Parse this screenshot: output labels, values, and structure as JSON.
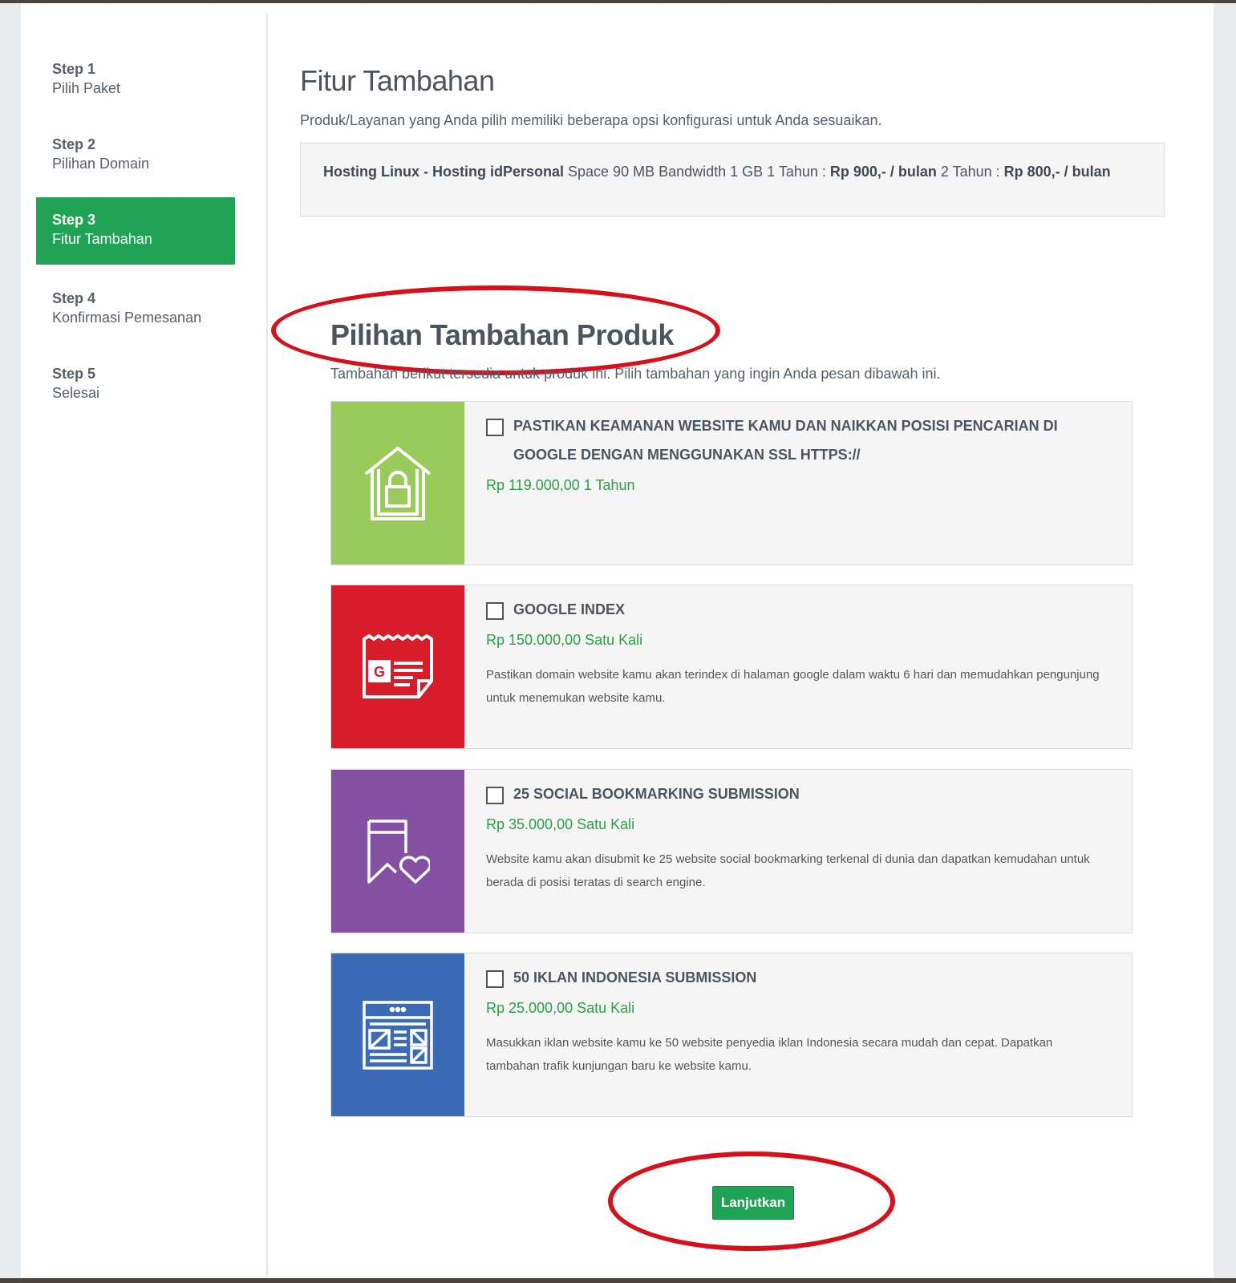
{
  "sidebar": {
    "steps": [
      {
        "num": "Step 1",
        "name": "Pilih Paket"
      },
      {
        "num": "Step 2",
        "name": "Pilihan Domain"
      },
      {
        "num": "Step 3",
        "name": "Fitur Tambahan"
      },
      {
        "num": "Step 4",
        "name": "Konfirmasi Pemesanan"
      },
      {
        "num": "Step 5",
        "name": "Selesai"
      }
    ]
  },
  "main": {
    "title": "Fitur Tambahan",
    "subtitle": "Produk/Layanan yang Anda pilih memiliki beberapa opsi konfigurasi untuk Anda sesuaikan.",
    "product": {
      "name": "Hosting Linux - Hosting idPersonal",
      "specs": " Space 90 MB Bandwidth 1 GB 1 Tahun : ",
      "price1": "Rp 900,- / bulan",
      "mid": " 2 Tahun : ",
      "price2": "Rp 800,- / bulan"
    },
    "addons_title": "Pilihan Tambahan Produk",
    "addons_subtitle": "Tambahan berikut tersedia untuk produk ini. Pilih tambahan yang ingin Anda pesan dibawah ini.",
    "addons": [
      {
        "title": "PASTIKAN KEAMANAN WEBSITE KAMU DAN NAIKKAN POSISI PENCARIAN DI GOOGLE DENGAN MENGGUNAKAN SSL HTTPS://",
        "price": "Rp 119.000,00 1 Tahun",
        "desc": "",
        "icon": "house-lock-icon",
        "color": "#98cb59"
      },
      {
        "title": "GOOGLE INDEX",
        "price": "Rp 150.000,00 Satu Kali",
        "desc": "Pastikan domain website kamu akan terindex di halaman google dalam waktu 6 hari dan memudahkan pengunjung untuk menemukan website kamu.",
        "icon": "google-doc-icon",
        "color": "#d91c29"
      },
      {
        "title": "25 SOCIAL BOOKMARKING SUBMISSION",
        "price": "Rp 35.000,00 Satu Kali",
        "desc": "Website kamu akan disubmit ke 25 website social bookmarking terkenal di dunia dan dapatkan kemudahan untuk berada di posisi teratas di search engine.",
        "icon": "bookmark-heart-icon",
        "color": "#8450a1"
      },
      {
        "title": "50 IKLAN INDONESIA SUBMISSION",
        "price": "Rp 25.000,00 Satu Kali",
        "desc": "Masukkan iklan website kamu ke 50 website penyedia iklan Indonesia secara mudah dan cepat. Dapatkan tambahan trafik kunjungan baru ke website kamu.",
        "icon": "newspaper-icon",
        "color": "#3b6bb5"
      }
    ],
    "continue_label": "Lanjutkan"
  },
  "colors": {
    "accent_green": "#1fa456",
    "price_green": "#2aa145",
    "highlight_red": "#d7111c"
  }
}
